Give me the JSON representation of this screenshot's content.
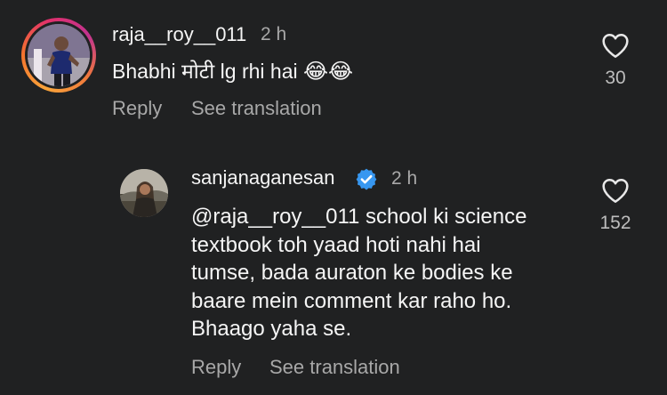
{
  "comment": {
    "username": "raja__roy__011",
    "time": "2 h",
    "text": "Bhabhi मोटी lg rhi hai",
    "emojis": "😂😂",
    "reply_label": "Reply",
    "translation_label": "See translation",
    "likes": "30"
  },
  "reply": {
    "username": "sanjanaganesan",
    "verified": true,
    "time": "2 h",
    "lines": [
      "@raja__roy__011 school ki science",
      "textbook toh yaad hoti nahi hai",
      "tumse, bada auraton ke bodies ke",
      "baare mein comment kar raho ho.",
      "Bhaago yaha se."
    ],
    "reply_label": "Reply",
    "translation_label": "See translation",
    "likes": "152"
  },
  "colors": {
    "background": "#202122",
    "text_primary": "#f5f5f5",
    "text_secondary": "#a8a8a8",
    "verified_blue": "#3797f0"
  },
  "icons": {
    "like": "heart-outline-icon",
    "verified": "verified-badge-icon"
  }
}
